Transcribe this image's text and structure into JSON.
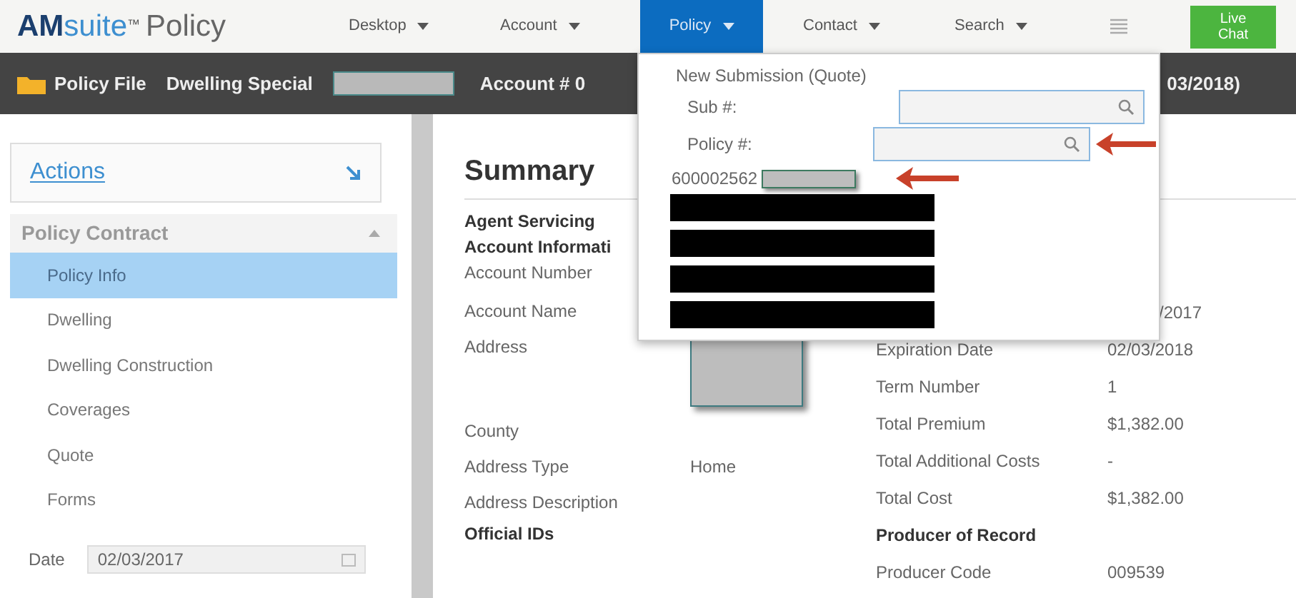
{
  "logo": {
    "brand": "AM",
    "product": "suite",
    "mark": "™",
    "name": "Policy"
  },
  "nav": [
    {
      "label": "Desktop",
      "selected": false
    },
    {
      "label": "Account",
      "selected": false
    },
    {
      "label": "Policy",
      "selected": true
    },
    {
      "label": "Contact",
      "selected": false
    },
    {
      "label": "Search",
      "selected": false
    }
  ],
  "live_chat": {
    "line1": "Live",
    "line2": "Chat"
  },
  "policy_bar": {
    "title": "Policy File",
    "product": "Dwelling Special",
    "account": "Account # 0",
    "term_end": "03/2018)"
  },
  "sidebar": {
    "actions": "Actions",
    "section": "Policy Contract",
    "expanded": true,
    "items": [
      {
        "label": "Policy Info",
        "selected": true
      },
      {
        "label": "Dwelling",
        "selected": false
      },
      {
        "label": "Dwelling Construction",
        "selected": false
      },
      {
        "label": "Coverages",
        "selected": false
      },
      {
        "label": "Quote",
        "selected": false
      },
      {
        "label": "Forms",
        "selected": false
      }
    ],
    "date": {
      "label": "Date",
      "value": "02/03/2017"
    }
  },
  "summary": {
    "title": "Summary",
    "left": [
      {
        "kind": "heading",
        "label": "Agent Servicing"
      },
      {
        "kind": "heading",
        "label": "Account Informati"
      },
      {
        "kind": "field",
        "label": "Account Number"
      },
      {
        "kind": "field",
        "label": "Account Name"
      },
      {
        "kind": "address",
        "label": "Address"
      },
      {
        "kind": "field",
        "label": "County"
      },
      {
        "kind": "field",
        "label": "Address Type",
        "value": "Home"
      },
      {
        "kind": "field",
        "label": "Address Description"
      },
      {
        "kind": "heading",
        "label": "Official IDs"
      }
    ],
    "right": [
      {
        "kind": "partial",
        "value": "/2017"
      },
      {
        "kind": "field",
        "label": "Expiration Date",
        "value": "02/03/2018"
      },
      {
        "kind": "field",
        "label": "Term Number",
        "value": "1"
      },
      {
        "kind": "field",
        "label": "Total Premium",
        "value": "$1,382.00"
      },
      {
        "kind": "field",
        "label": "Total Additional Costs",
        "value": "-"
      },
      {
        "kind": "field",
        "label": "Total Cost",
        "value": "$1,382.00"
      },
      {
        "kind": "heading",
        "label": "Producer of Record"
      },
      {
        "kind": "field",
        "label": "Producer Code",
        "value": "009539"
      }
    ]
  },
  "policy_menu": {
    "new_submission": "New Submission (Quote)",
    "sub_label": "Sub #:",
    "policy_label": "Policy #:",
    "recent": "600002562",
    "redacted_rows": [
      {
        "kind": "redaction"
      },
      {
        "kind": "redaction"
      },
      {
        "kind": "redaction"
      },
      {
        "kind": "redaction"
      }
    ]
  }
}
